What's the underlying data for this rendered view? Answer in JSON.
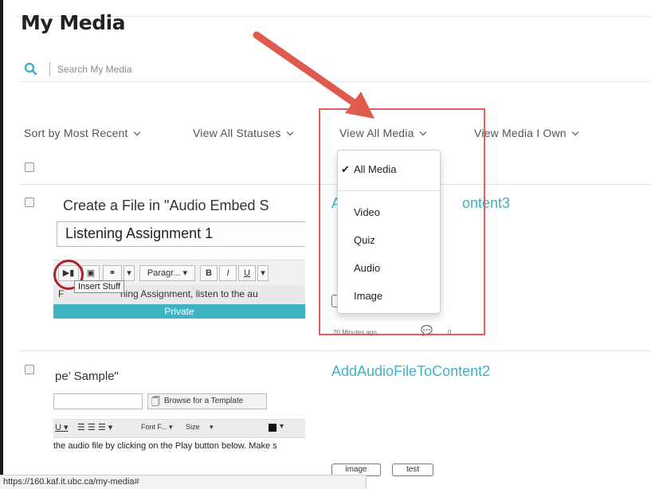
{
  "page": {
    "title": "My Media"
  },
  "search": {
    "placeholder": "Search My Media"
  },
  "filters": {
    "sort_label": "Sort by Most Recent",
    "statuses_label": "View All Statuses",
    "media_label": "View All Media",
    "own_label": "View Media I Own"
  },
  "dropdown": {
    "selected": "All Media",
    "items": [
      "Video",
      "Quiz",
      "Audio",
      "Image"
    ]
  },
  "media": [
    {
      "title_left": "A",
      "title_right": "ontent3",
      "thumb": {
        "title": "Create a File in \"Audio Embed S",
        "box_text": "Listening Assignment 1",
        "toolbar_paragraph": "Paragr...",
        "tooltip": "Insert Stuff",
        "content_prefix": "F",
        "content_text": "ning Assignment, listen to the au",
        "private_label": "Private"
      },
      "meta_time": "20 Minutes ago",
      "meta_comments": "0"
    },
    {
      "title": "AddAudioFileToContent2",
      "thumb": {
        "title": "pe’ Sample\"",
        "browse_label": "Browse for a Template",
        "font_label": "Font F...",
        "size_label": "Size",
        "content_text": "the audio file by clicking on the Play button below.  Make s"
      },
      "tags": [
        "image",
        "test"
      ]
    }
  ],
  "status_bar": {
    "url": "https://160.kaf.it.ubc.ca/my-media#"
  },
  "colors": {
    "link": "#3eb3c3",
    "annotation_red": "#e05a4f"
  }
}
